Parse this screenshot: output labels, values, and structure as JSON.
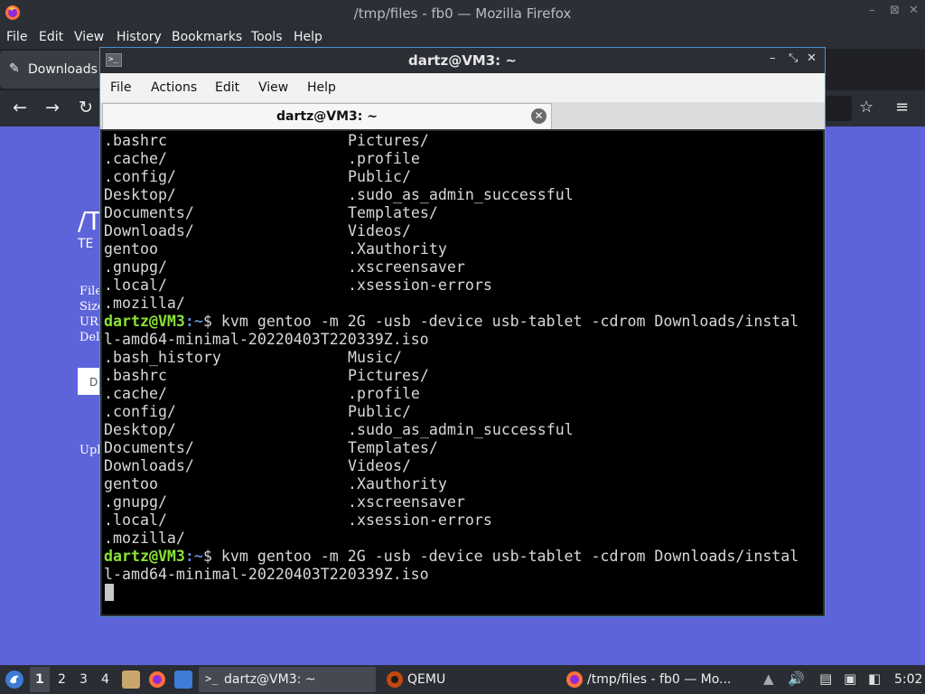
{
  "firefox": {
    "window_title": "/tmp/files - fb0 — Mozilla Firefox",
    "window_controls": [
      "–",
      "⊠",
      "✕"
    ],
    "menu": [
      "File",
      "Edit",
      "View",
      "History",
      "Bookmarks",
      "Tools",
      "Help"
    ],
    "tab_label": "Downloads",
    "content": {
      "heading_partial": "/T",
      "subheading_partial": "TE",
      "rows_partial": [
        "File",
        "Size",
        "URL",
        "Dele"
      ],
      "button_partial": "D",
      "footer_partial": "Uplo"
    }
  },
  "terminal": {
    "window_title": "dartz@VM3: ~",
    "window_controls": [
      "–",
      "⤡",
      "✕"
    ],
    "menu": [
      "File",
      "Actions",
      "Edit",
      "View",
      "Help"
    ],
    "tab_label": "dartz@VM3: ~",
    "prompt": {
      "user_host": "dartz@VM3",
      "path": ":~",
      "symbol": "$"
    },
    "lines": [
      {
        "type": "ls",
        "c1": ".bashrc",
        "c2": "Pictures/"
      },
      {
        "type": "ls",
        "c1": ".cache/",
        "c2": ".profile"
      },
      {
        "type": "ls",
        "c1": ".config/",
        "c2": "Public/"
      },
      {
        "type": "ls",
        "c1": "Desktop/",
        "c2": ".sudo_as_admin_successful"
      },
      {
        "type": "ls",
        "c1": "Documents/",
        "c2": "Templates/"
      },
      {
        "type": "ls",
        "c1": "Downloads/",
        "c2": "Videos/"
      },
      {
        "type": "ls",
        "c1": "gentoo",
        "c2": ".Xauthority"
      },
      {
        "type": "ls",
        "c1": ".gnupg/",
        "c2": ".xscreensaver"
      },
      {
        "type": "ls",
        "c1": ".local/",
        "c2": ".xsession-errors"
      },
      {
        "type": "ls",
        "c1": ".mozilla/",
        "c2": ""
      },
      {
        "type": "cmd",
        "text": " kvm gentoo -m 2G -usb -device usb-tablet -cdrom Downloads/instal"
      },
      {
        "type": "text",
        "text": "l-amd64-minimal-20220403T220339Z.iso"
      },
      {
        "type": "ls",
        "c1": ".bash_history",
        "c2": "Music/"
      },
      {
        "type": "ls",
        "c1": ".bashrc",
        "c2": "Pictures/"
      },
      {
        "type": "ls",
        "c1": ".cache/",
        "c2": ".profile"
      },
      {
        "type": "ls",
        "c1": ".config/",
        "c2": "Public/"
      },
      {
        "type": "ls",
        "c1": "Desktop/",
        "c2": ".sudo_as_admin_successful"
      },
      {
        "type": "ls",
        "c1": "Documents/",
        "c2": "Templates/"
      },
      {
        "type": "ls",
        "c1": "Downloads/",
        "c2": "Videos/"
      },
      {
        "type": "ls",
        "c1": "gentoo",
        "c2": ".Xauthority"
      },
      {
        "type": "ls",
        "c1": ".gnupg/",
        "c2": ".xscreensaver"
      },
      {
        "type": "ls",
        "c1": ".local/",
        "c2": ".xsession-errors"
      },
      {
        "type": "ls",
        "c1": ".mozilla/",
        "c2": ""
      },
      {
        "type": "cmd",
        "text": " kvm gentoo -m 2G -usb -device usb-tablet -cdrom Downloads/instal"
      },
      {
        "type": "text",
        "text": "l-amd64-minimal-20220403T220339Z.iso"
      }
    ]
  },
  "taskbar": {
    "workspaces": [
      "1",
      "2",
      "3",
      "4"
    ],
    "active_workspace": "1",
    "tasks": [
      {
        "label": "dartz@VM3: ~",
        "icon": "terminal-icon"
      },
      {
        "label": "QEMU",
        "icon": "qemu-icon"
      },
      {
        "label": "/tmp/files - fb0 — Mo...",
        "icon": "firefox-icon"
      }
    ],
    "clock": "5:02"
  },
  "colors": {
    "desktop_bg": "#5d63d8",
    "prompt_user": "#8ae234",
    "prompt_path": "#5f8fd6",
    "terminal_bg": "#000000",
    "terminal_fg": "#d8d8d8",
    "taskbar_bg": "#2a2d33"
  }
}
